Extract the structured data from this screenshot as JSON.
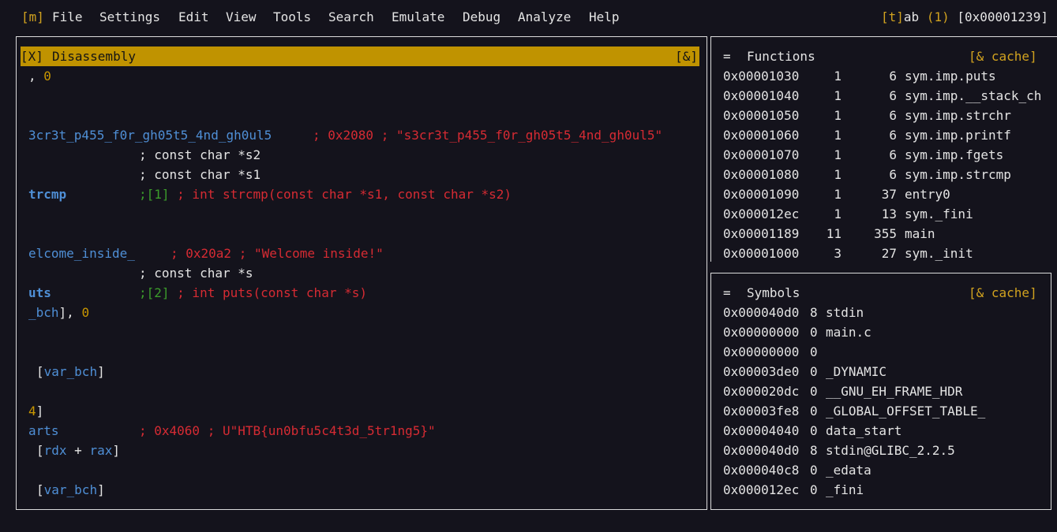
{
  "menubar": {
    "m_key": "[m]",
    "items": [
      "File",
      "Settings",
      "Edit",
      "View",
      "Tools",
      "Search",
      "Emulate",
      "Debug",
      "Analyze",
      "Help"
    ],
    "tab_prefix": "[t]",
    "tab_label": "ab",
    "tab_count": "(1)",
    "address": "[0x00001239]"
  },
  "disasm": {
    "close": "[X]",
    "title": "Disassembly",
    "menu": "[&]",
    "l1_a": ", ",
    "l1_b": "0",
    "l2_sym": "3cr3t_p455_f0r_gh05t5_4nd_gh0ul5",
    "l2_comment": "; 0x2080 ; \"s3cr3t_p455_f0r_gh05t5_4nd_gh0ul5\"",
    "l3": "; const char *s2",
    "l4": "; const char *s1",
    "l5_sym": "trcmp",
    "l5_ref": ";[1]",
    "l5_comment": " ; int strcmp(const char *s1, const char *s2)",
    "l6_sym": "elcome_inside_",
    "l6_comment": "; 0x20a2 ; \"Welcome inside!\"",
    "l7": "; const char *s",
    "l8_sym": "uts",
    "l8_ref": ";[2]",
    "l8_comment": " ; int puts(const char *s)",
    "l9_sym": "_bch",
    "l9_rest": "], ",
    "l9_num": "0",
    "l10_open": "[",
    "l10_var": "var_bch",
    "l10_close": "]",
    "l11_num": "4",
    "l11_close": "]",
    "l12_sym": "arts",
    "l12_comment": "; 0x4060 ; U\"HTB{un0bfu5c4t3d_5tr1ng5}\"",
    "l13_open": "[",
    "l13_reg1": "rdx",
    "l13_plus": " + ",
    "l13_reg2": "rax",
    "l13_close": "]",
    "l14_open": "[",
    "l14_var": "var_bch",
    "l14_close": "]"
  },
  "functions": {
    "marker": "=",
    "title": "Functions",
    "cache": "[& cache]",
    "rows": [
      {
        "addr": "0x00001030",
        "n": "1",
        "size": "6",
        "name": "sym.imp.puts"
      },
      {
        "addr": "0x00001040",
        "n": "1",
        "size": "6",
        "name": "sym.imp.__stack_ch"
      },
      {
        "addr": "0x00001050",
        "n": "1",
        "size": "6",
        "name": "sym.imp.strchr"
      },
      {
        "addr": "0x00001060",
        "n": "1",
        "size": "6",
        "name": "sym.imp.printf"
      },
      {
        "addr": "0x00001070",
        "n": "1",
        "size": "6",
        "name": "sym.imp.fgets"
      },
      {
        "addr": "0x00001080",
        "n": "1",
        "size": "6",
        "name": "sym.imp.strcmp"
      },
      {
        "addr": "0x00001090",
        "n": "1",
        "size": "37",
        "name": "entry0"
      },
      {
        "addr": "0x000012ec",
        "n": "1",
        "size": "13",
        "name": "sym._fini"
      },
      {
        "addr": "0x00001189",
        "n": "11",
        "size": "355",
        "name": "main"
      },
      {
        "addr": "0x00001000",
        "n": "3",
        "size": "27",
        "name": "sym._init"
      }
    ]
  },
  "symbols": {
    "marker": "=",
    "title": "Symbols",
    "cache": "[& cache]",
    "rows": [
      {
        "addr": "0x000040d0",
        "size": "8",
        "name": "stdin"
      },
      {
        "addr": "0x00000000",
        "size": "0",
        "name": "main.c"
      },
      {
        "addr": "0x00000000",
        "size": "0",
        "name": ""
      },
      {
        "addr": "0x00003de0",
        "size": "0",
        "name": "_DYNAMIC"
      },
      {
        "addr": "0x000020dc",
        "size": "0",
        "name": "__GNU_EH_FRAME_HDR"
      },
      {
        "addr": "0x00003fe8",
        "size": "0",
        "name": "_GLOBAL_OFFSET_TABLE_"
      },
      {
        "addr": "0x00004040",
        "size": "0",
        "name": "data_start"
      },
      {
        "addr": "0x000040d0",
        "size": "8",
        "name": "stdin@GLIBC_2.2.5"
      },
      {
        "addr": "0x000040c8",
        "size": "0",
        "name": "_edata"
      },
      {
        "addr": "0x000012ec",
        "size": "0",
        "name": "_fini"
      }
    ]
  },
  "colors": {
    "background": "#14131c",
    "title_bar": "#c09300",
    "symbol_blue": "#4f8fd6",
    "comment_red": "#d62b33",
    "ref_green": "#3c9d2b",
    "number_gold": "#c99700"
  }
}
